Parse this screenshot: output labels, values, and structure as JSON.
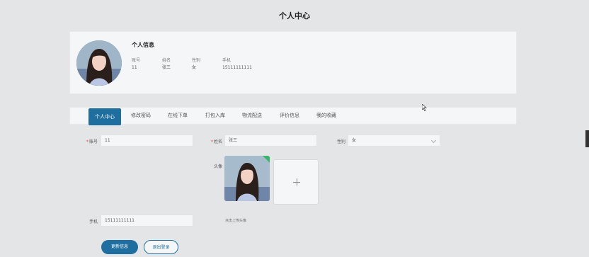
{
  "page_title": "个人中心",
  "card": {
    "heading": "个人信息",
    "fields": [
      {
        "label": "账号",
        "value": "11"
      },
      {
        "label": "姓名",
        "value": "张三"
      },
      {
        "label": "性别",
        "value": "女"
      },
      {
        "label": "手机",
        "value": "15111111111"
      }
    ]
  },
  "tabs": [
    "个人中心",
    "修改密码",
    "在线下单",
    "打包入库",
    "物流配送",
    "评价信息",
    "我的收藏"
  ],
  "form": {
    "account_label": "账号",
    "account_value": "11",
    "name_label": "姓名",
    "name_value": "张三",
    "gender_label": "性别",
    "gender_value": "女",
    "avatar_label": "头像",
    "upload_hint": "点击上传头像",
    "phone_label": "手机",
    "phone_value": "15111111111",
    "required_mark": "*"
  },
  "buttons": {
    "update": "更新信息",
    "logout": "退出登录"
  },
  "colors": {
    "primary": "#1e6f9f",
    "background": "#e4e5e7",
    "card": "#f5f6f7",
    "success": "#3ab56a"
  }
}
